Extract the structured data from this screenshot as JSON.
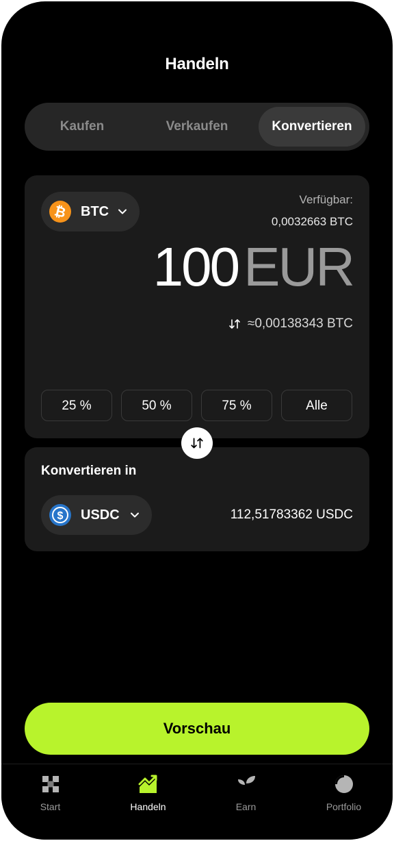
{
  "header": {
    "title": "Handeln"
  },
  "segments": {
    "buy": "Kaufen",
    "sell": "Verkaufen",
    "convert": "Konvertieren",
    "active": "convert"
  },
  "from": {
    "asset": "BTC",
    "available_label": "Verfügbar:",
    "available_value": "0,0032663 BTC",
    "amount": "100",
    "currency": "EUR",
    "approx": "≈0,00138343 BTC",
    "percent_buttons": [
      "25 %",
      "50 %",
      "75 %",
      "Alle"
    ]
  },
  "to": {
    "label": "Konvertieren in",
    "asset": "USDC",
    "value": "112,51783362 USDC"
  },
  "cta": {
    "label": "Vorschau"
  },
  "tabs": [
    {
      "label": "Start",
      "icon": "start-icon"
    },
    {
      "label": "Handeln",
      "icon": "trade-chart-icon"
    },
    {
      "label": "Earn",
      "icon": "sprout-icon"
    },
    {
      "label": "Portfolio",
      "icon": "pie-chart-icon"
    }
  ],
  "colors": {
    "accent": "#b8f32c",
    "background": "#000000",
    "card": "#1b1b1b",
    "btc": "#f7931a",
    "usdc": "#2775ca"
  }
}
